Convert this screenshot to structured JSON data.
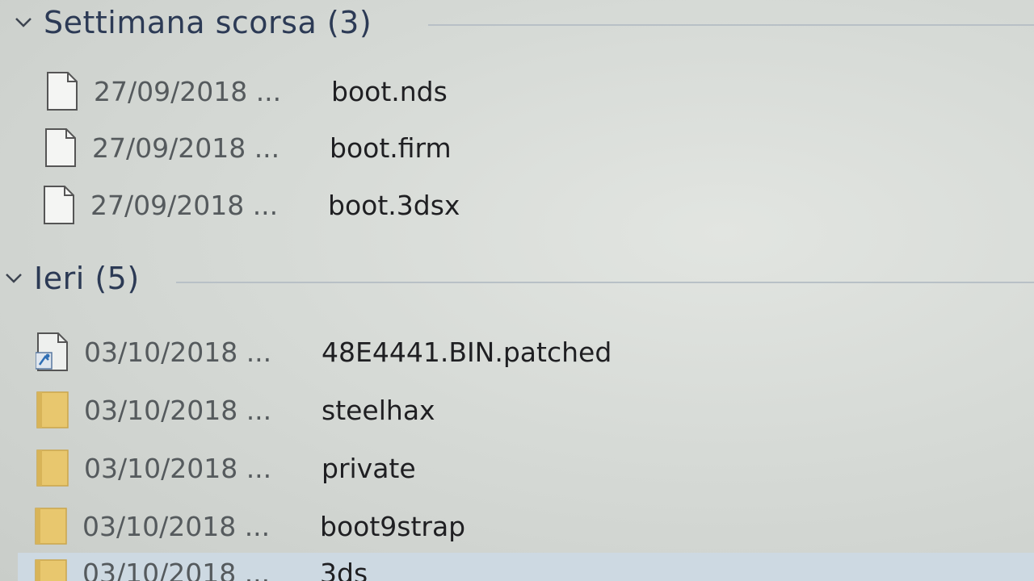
{
  "groups": [
    {
      "title": "Settimana scorsa (3)",
      "items": [
        {
          "date": "27/09/2018 ...",
          "name": "boot.nds",
          "icon": "file-icon"
        },
        {
          "date": "27/09/2018 ...",
          "name": "boot.firm",
          "icon": "file-icon"
        },
        {
          "date": "27/09/2018 ...",
          "name": "boot.3dsx",
          "icon": "file-icon"
        }
      ]
    },
    {
      "title": "Ieri (5)",
      "items": [
        {
          "date": "03/10/2018 ...",
          "name": "48E4441.BIN.patched",
          "icon": "binary-file-icon"
        },
        {
          "date": "03/10/2018 ...",
          "name": "steelhax",
          "icon": "folder-icon"
        },
        {
          "date": "03/10/2018 ...",
          "name": "private",
          "icon": "folder-icon"
        },
        {
          "date": "03/10/2018 ...",
          "name": "boot9strap",
          "icon": "folder-icon"
        },
        {
          "date": "03/10/2018 ...",
          "name": "3ds",
          "icon": "folder-icon"
        }
      ]
    }
  ],
  "colors": {
    "folder": "#e8c76e",
    "file_outline": "#555555",
    "header_text": "#2c3a55",
    "selection": "#cdd9e2"
  }
}
